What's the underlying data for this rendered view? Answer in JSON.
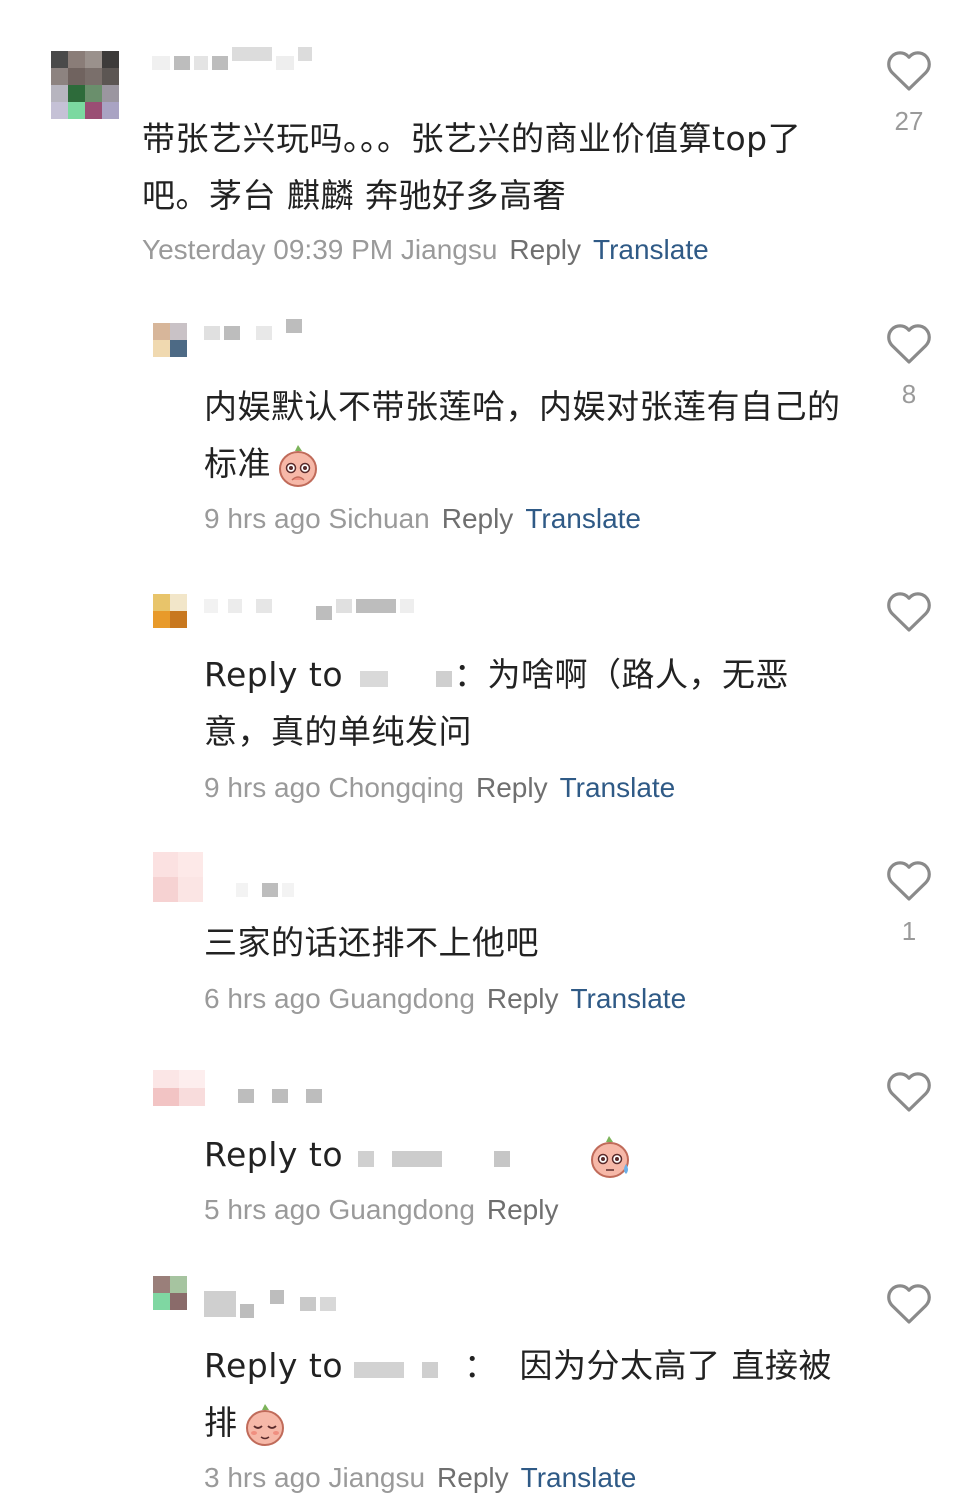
{
  "comments": [
    {
      "text": "带张艺兴玩吗。。。张艺兴的商业价值算top了吧。茅台 麒麟 奔驰好多高奢",
      "time": "Yesterday 09:39 PM",
      "location": "Jiangsu",
      "reply_label": "Reply",
      "translate_label": "Translate",
      "likes": "27"
    },
    {
      "text": "内娱默认不带张莲哈，内娱对张莲有自己的标准",
      "time": "9 hrs ago",
      "location": "Sichuan",
      "reply_label": "Reply",
      "translate_label": "Translate",
      "likes": "8"
    },
    {
      "reply_prefix": "Reply to",
      "text": "：为啥啊（路人，无恶意，真的单纯发问",
      "time": "9 hrs ago",
      "location": "Chongqing",
      "reply_label": "Reply",
      "translate_label": "Translate",
      "likes": ""
    },
    {
      "text": "三家的话还排不上他吧",
      "time": "6 hrs ago",
      "location": "Guangdong",
      "reply_label": "Reply",
      "translate_label": "Translate",
      "likes": "1"
    },
    {
      "reply_prefix": "Reply to",
      "time": "5 hrs ago",
      "location": "Guangdong",
      "reply_label": "Reply",
      "likes": ""
    },
    {
      "reply_prefix": "Reply to",
      "text": "：  因为分太高了 直接被排",
      "time": "3 hrs ago",
      "location": "Jiangsu",
      "reply_label": "Reply",
      "translate_label": "Translate",
      "likes": ""
    }
  ],
  "icons": {
    "like": "heart-outline-icon",
    "emoji": "peach-face-emoji"
  },
  "colors": {
    "text": "#222222",
    "meta": "#9a9a9a",
    "translate": "#2f5a86",
    "icon": "#8a8a8a"
  }
}
